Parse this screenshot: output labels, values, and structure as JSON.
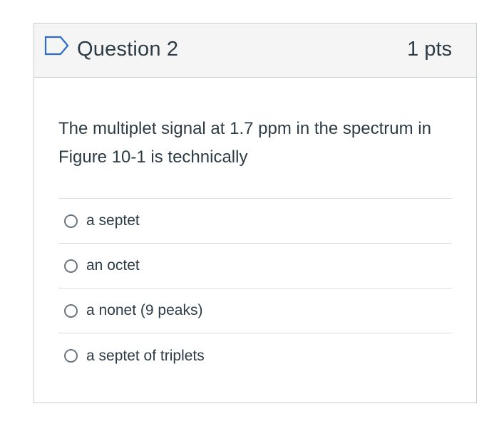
{
  "question": {
    "title": "Question 2",
    "points": "1 pts",
    "text": "The multiplet signal at 1.7 ppm in the spectrum in Figure 10-1 is technically",
    "flag_icon": "bookmark-flag-icon",
    "accent_color": "#2d6ccf",
    "answers": [
      {
        "label": "a septet",
        "selected": false
      },
      {
        "label": "an octet",
        "selected": false
      },
      {
        "label": "a nonet (9 peaks)",
        "selected": false
      },
      {
        "label": "a septet of triplets",
        "selected": false
      }
    ]
  }
}
